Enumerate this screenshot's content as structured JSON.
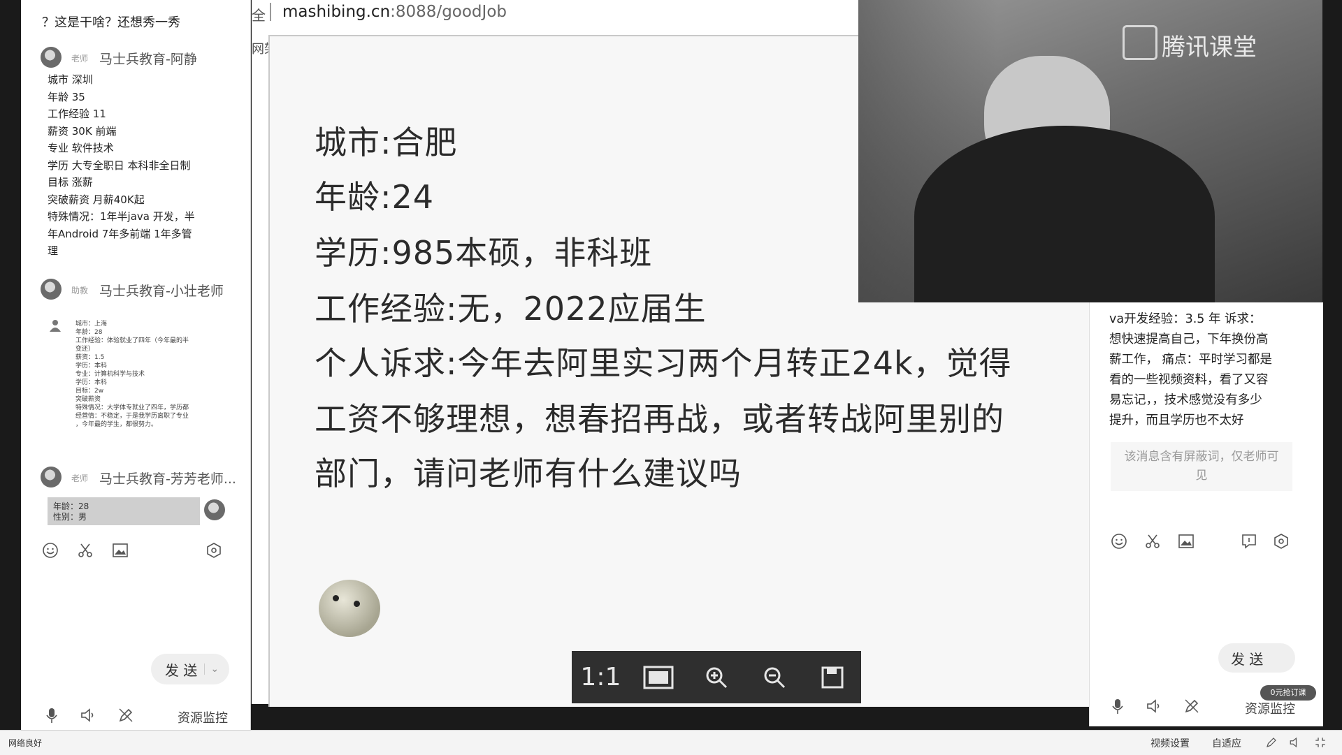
{
  "left_chat": {
    "top_message": "？这是干啥？还想秀一秀",
    "msg1": {
      "role": "老师",
      "name": "马士兵教育-阿静",
      "lines": [
        "城市 深圳",
        "年龄 35",
        "工作经验 11",
        "薪资 30K 前端",
        "专业 软件技术",
        "学历 大专全职日 本科非全日制",
        "目标 涨薪",
        "突破薪资 月薪40K起",
        "特殊情况：1年半java 开发，半",
        "年Android 7年多前端 1年多管",
        "理"
      ]
    },
    "msg2": {
      "role": "助教",
      "name": "马士兵教育-小壮老师",
      "lines": [
        "城市：上海",
        "年龄：28",
        "工作经验：体验就业了四年（今年最的半",
        "变还）",
        "薪资：1.5",
        "学历：本科",
        "专业：计算机科学与技术",
        "学历：本科",
        "目标：2w",
        "突破薪资",
        "特殊情况：大学体专就业了四年，学历都",
        "经营情：不稳定，于是我学历离职了专业",
        "，今年最的学生，都很努力。"
      ]
    },
    "msg3": {
      "role": "老师",
      "name": "马士兵教育-芳芳老师...",
      "quote_lines": [
        "年龄：28",
        "性别：男"
      ]
    },
    "send_label": "发 送",
    "resource_label": "资源监控"
  },
  "browser": {
    "url_prefix": "全",
    "url_host": "mashibing.cn",
    "url_rest": ":8088/goodJob",
    "side_fragment": "网架"
  },
  "slide": {
    "lines": [
      "城市:合肥",
      "年龄:24",
      "学历:985本硕，非科班",
      "工作经验:无，2022应届生",
      "个人诉求:今年去阿里实习两个月转正24k，觉得",
      "工资不够理想，想春招再战，或者转战阿里别的",
      "部门，请问老师有什么建议吗"
    ]
  },
  "zoom_toolbar": {
    "one_to_one": "1:1"
  },
  "video": {
    "brand": "腾讯课堂"
  },
  "right_chat": {
    "message_lines": [
      "va开发经验：3.5  年 诉求：",
      "想快速提高自己，下年换份高",
      "薪工作，  痛点：平时学习都是",
      "看的一些视频资料，看了又容",
      "易忘记，，技术感觉没有多少",
      "提升，而且学历也不太好"
    ],
    "blocked_notice": "该消息含有屏蔽词，仅老师可见",
    "send_label": "发 送",
    "badge": "0元抢订课",
    "resource_label": "资源监控"
  },
  "status_bar": {
    "network": "网络良好",
    "video_settings": "视频设置",
    "adapt": "自适应"
  }
}
